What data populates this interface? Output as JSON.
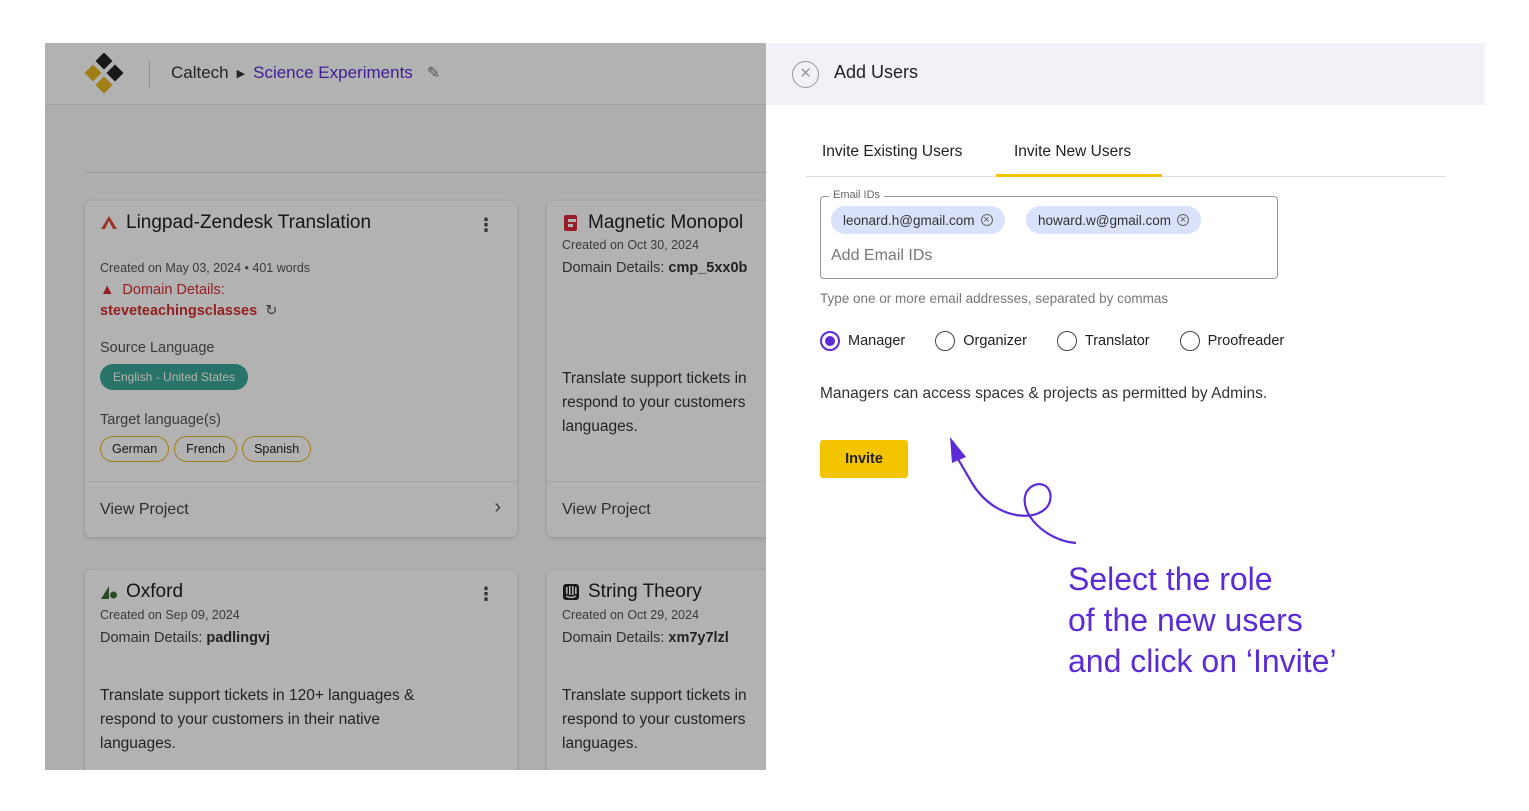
{
  "header": {
    "org": "Caltech",
    "space": "Science Experiments"
  },
  "cards": [
    {
      "title": "Lingpad-Zendesk Translation",
      "created": "Created on May 03, 2024 • 401 words",
      "domain_error_label": "Domain Details:",
      "domain_error_value": "steveteachingsclasses",
      "source_label": "Source Language",
      "source_language": "English - United States",
      "target_label": "Target language(s)",
      "targets": [
        "German",
        "French",
        "Spanish"
      ],
      "view": "View Project"
    },
    {
      "title": "Magnetic Monopol",
      "created": "Created on Oct 30, 2024",
      "domain_label": "Domain Details:",
      "domain_value": "cmp_5xx0b",
      "desc": [
        "Translate support tickets in",
        "respond to your customers",
        "languages."
      ],
      "view": "View Project"
    },
    {
      "title": "Oxford",
      "created": "Created on Sep 09, 2024",
      "domain_label": "Domain Details:",
      "domain_value": "padlingvj",
      "desc": [
        "Translate support tickets in 120+ languages &",
        "respond to your customers in their native",
        "languages."
      ]
    },
    {
      "title": "String Theory",
      "created": "Created on Oct 29, 2024",
      "domain_label": "Domain Details:",
      "domain_value": "xm7y7lzl",
      "desc": [
        "Translate support tickets in",
        "respond to your customers",
        "languages."
      ]
    }
  ],
  "panel": {
    "title": "Add Users",
    "tabs": [
      "Invite Existing Users",
      "Invite New Users"
    ],
    "active_tab": "Invite New Users",
    "email_legend": "Email IDs",
    "emails": [
      "leonard.h@gmail.com",
      "howard.w@gmail.com"
    ],
    "email_placeholder": "Add Email IDs",
    "helper": "Type one or more email addresses, separated by commas",
    "roles": [
      "Manager",
      "Organizer",
      "Translator",
      "Proofreader"
    ],
    "selected_role": "Manager",
    "role_description": "Managers can access spaces & projects as permitted by Admins.",
    "invite_label": "Invite"
  },
  "annotation": [
    "Select the role",
    "of the new users",
    "and click on ‘Invite’"
  ],
  "colors": {
    "accent": "#5b2bd5",
    "button": "#f5c400",
    "teal": "#3aa795",
    "error": "#d32f2f"
  }
}
